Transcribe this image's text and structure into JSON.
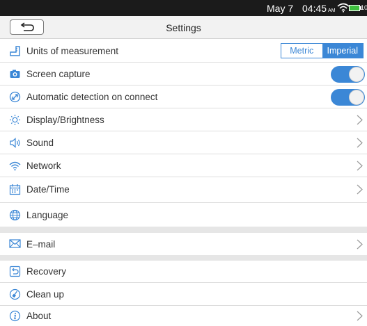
{
  "status_bar": {
    "date": "May 7",
    "time": "04:45",
    "ampm": "AM",
    "battery": "100%"
  },
  "header": {
    "title": "Settings"
  },
  "units": {
    "label": "Units of measurement",
    "options": [
      "Metric",
      "Imperial"
    ],
    "selected": "Imperial"
  },
  "screen_capture": {
    "label": "Screen capture",
    "enabled": true
  },
  "auto_detect": {
    "label": "Automatic detection on connect",
    "enabled": true
  },
  "items": {
    "display": "Display/Brightness",
    "sound": "Sound",
    "network": "Network",
    "datetime": "Date/Time",
    "language": "Language",
    "email": "E–mail",
    "recovery": "Recovery",
    "cleanup": "Clean up",
    "about": "About"
  },
  "colors": {
    "accent": "#3b87d6",
    "statusbar": "#1b1b1b",
    "battery": "#3ec13e"
  },
  "icons": [
    "back-arrow-icon",
    "ruler-icon",
    "camera-icon",
    "link-icon",
    "sun-icon",
    "speaker-icon",
    "wifi-icon",
    "calendar-icon",
    "globe-icon",
    "envelope-icon",
    "recovery-icon",
    "broom-icon",
    "info-icon",
    "chevron-right-icon"
  ]
}
